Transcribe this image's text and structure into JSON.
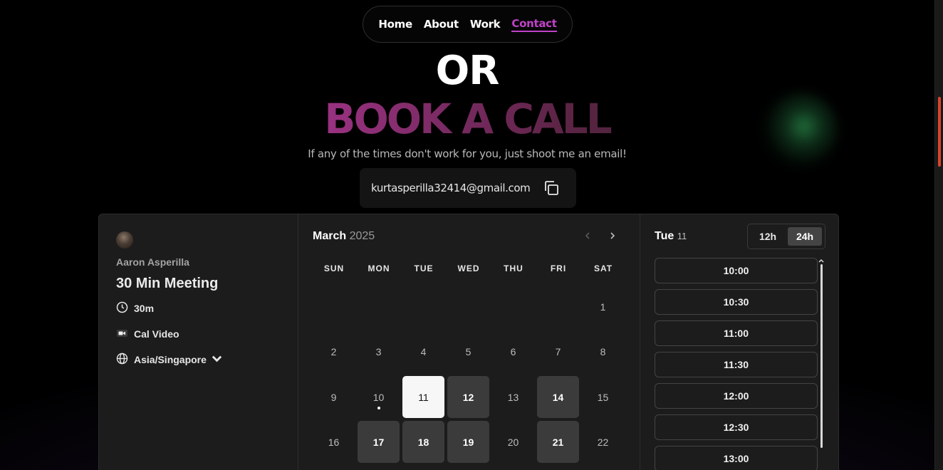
{
  "nav": {
    "items": [
      {
        "label": "Home"
      },
      {
        "label": "About"
      },
      {
        "label": "Work"
      },
      {
        "label": "Contact",
        "active": true
      }
    ]
  },
  "hero": {
    "or_text": "OR",
    "heading": "BOOK A CALL",
    "subtitle": "If any of the times don't work for you, just shoot me an email!",
    "email": "kurtasperilla32414@gmail.com"
  },
  "booker": {
    "host_name": "Aaron Asperilla",
    "event_title": "30 Min Meeting",
    "duration": "30m",
    "location": "Cal Video",
    "timezone": "Asia/Singapore",
    "calendar": {
      "month": "March",
      "year": "2025",
      "weekdays": [
        "SUN",
        "MON",
        "TUE",
        "WED",
        "THU",
        "FRI",
        "SAT"
      ],
      "weeks": [
        [
          "",
          "",
          "",
          "",
          "",
          "",
          "1"
        ],
        [
          "2",
          "3",
          "4",
          "5",
          "6",
          "7",
          "8"
        ],
        [
          "9",
          "10",
          "11",
          "12",
          "13",
          "14",
          "15"
        ],
        [
          "16",
          "17",
          "18",
          "19",
          "20",
          "21",
          "22"
        ]
      ],
      "selected": "11",
      "today": "10",
      "available": [
        "12",
        "14",
        "17",
        "18",
        "19",
        "21"
      ]
    },
    "slots": {
      "day_label": "Tue",
      "day_number": "11",
      "format_12h": "12h",
      "format_24h": "24h",
      "active_format": "24h",
      "times": [
        "10:00",
        "10:30",
        "11:00",
        "11:30",
        "12:00",
        "12:30",
        "13:00"
      ]
    }
  },
  "colors": {
    "accent": "#c041c8",
    "panel": "#1c1c1c",
    "available_day": "#3b3b3b",
    "selected_day": "#f7f7f7"
  }
}
